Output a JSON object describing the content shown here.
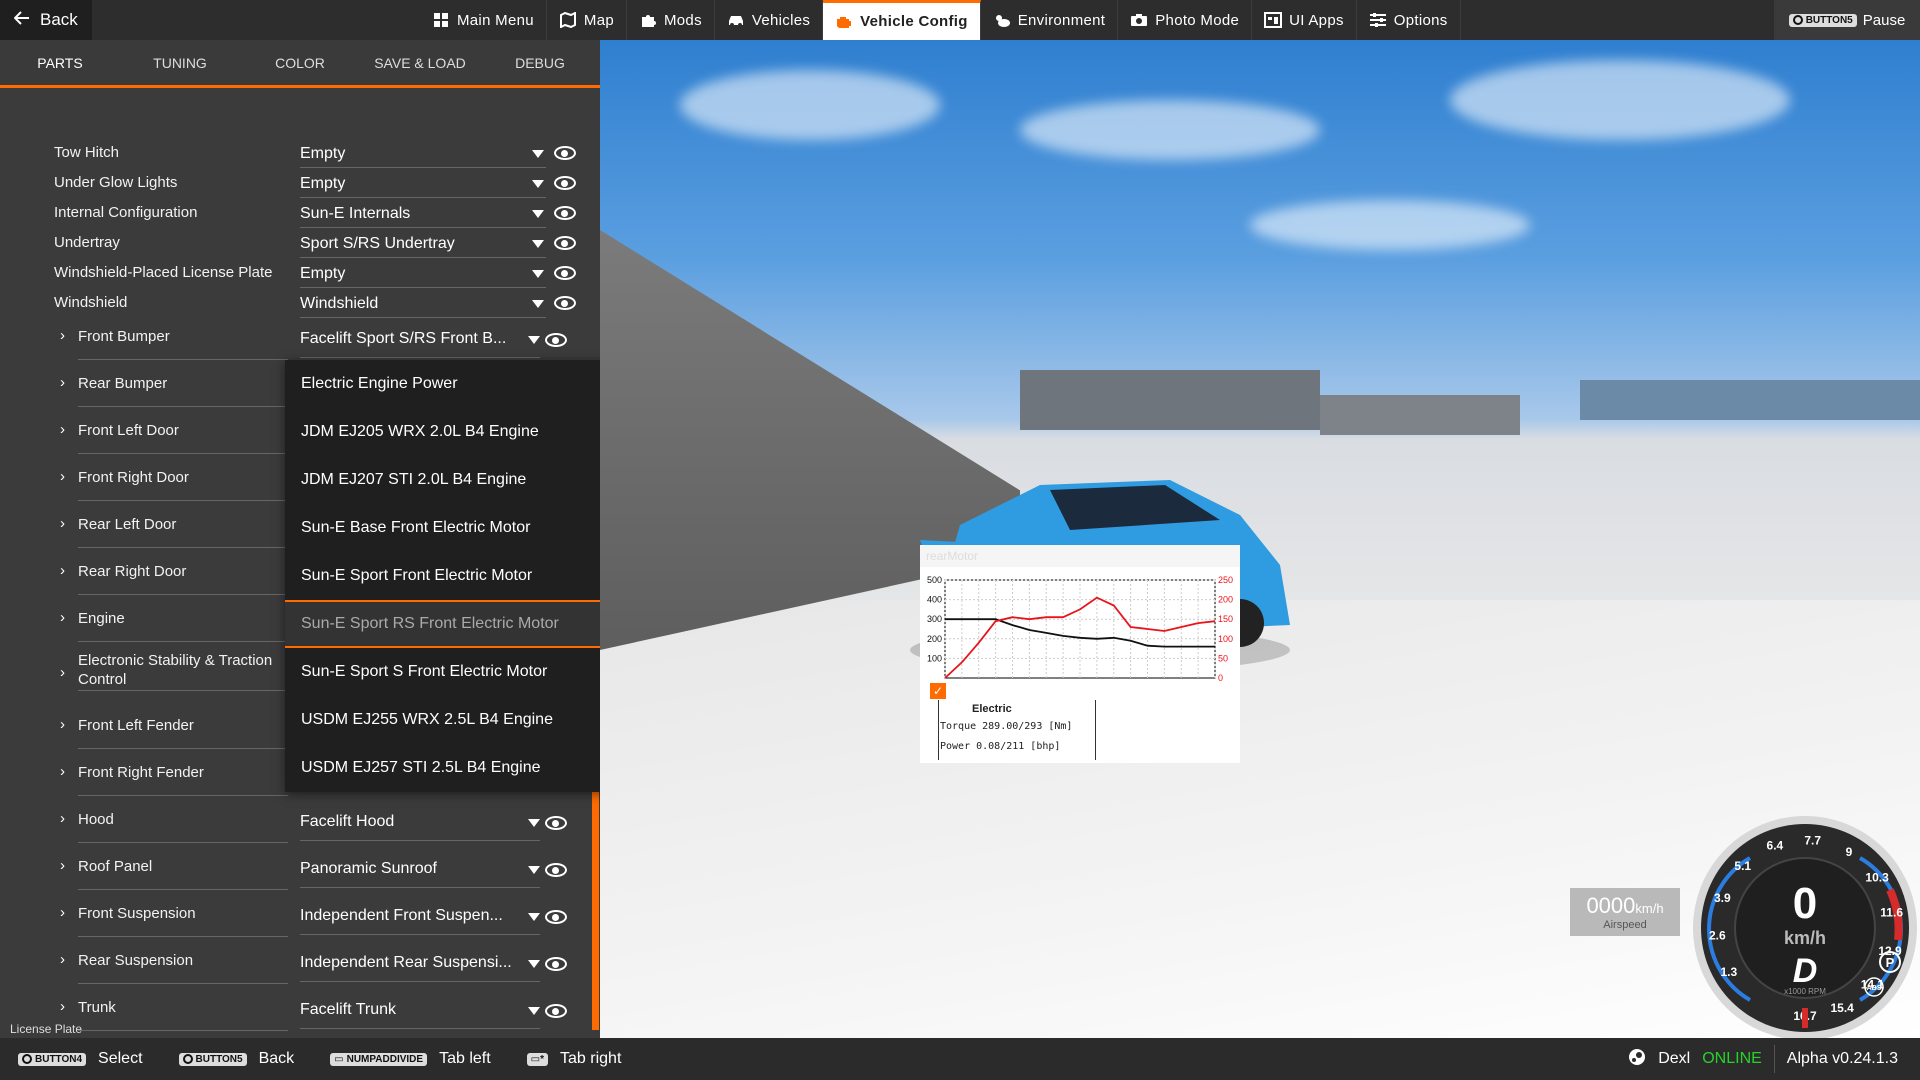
{
  "topbar": {
    "back_label": "Back",
    "nav": [
      {
        "label": "Main Menu",
        "icon": "grid-icon"
      },
      {
        "label": "Map",
        "icon": "map-icon"
      },
      {
        "label": "Mods",
        "icon": "puzzle-icon"
      },
      {
        "label": "Vehicles",
        "icon": "car-icon"
      },
      {
        "label": "Vehicle Config",
        "icon": "engine-icon",
        "active": true
      },
      {
        "label": "Environment",
        "icon": "weather-icon"
      },
      {
        "label": "Photo Mode",
        "icon": "camera-icon"
      },
      {
        "label": "UI Apps",
        "icon": "apps-icon"
      },
      {
        "label": "Options",
        "icon": "sliders-icon"
      }
    ],
    "pause_key": "BUTTON5",
    "pause_label": "Pause"
  },
  "panel": {
    "tabs": [
      "PARTS",
      "TUNING",
      "COLOR",
      "SAVE & LOAD",
      "DEBUG"
    ],
    "simple_rows": [
      {
        "label": "Tow Hitch",
        "value": "Empty"
      },
      {
        "label": "Under Glow Lights",
        "value": "Empty"
      },
      {
        "label": "Internal Configuration",
        "value": "Sun-E Internals"
      },
      {
        "label": "Undertray",
        "value": "Sport S/RS Undertray"
      },
      {
        "label": "Windshield-Placed License Plate",
        "value": "Empty"
      },
      {
        "label": "Windshield",
        "value": "Windshield"
      }
    ],
    "expand_rows": [
      {
        "label": "Front Bumper",
        "value": "Facelift Sport S/RS Front B..."
      },
      {
        "label": "Rear Bumper",
        "value": ""
      },
      {
        "label": "Front Left Door",
        "value": ""
      },
      {
        "label": "Front Right Door",
        "value": ""
      },
      {
        "label": "Rear Left Door",
        "value": ""
      },
      {
        "label": "Rear Right Door",
        "value": ""
      },
      {
        "label": "Engine",
        "value": ""
      },
      {
        "label": "Electronic Stability & Traction Control",
        "value": ""
      },
      {
        "label": "Front Left Fender",
        "value": ""
      },
      {
        "label": "Front Right Fender",
        "value": ""
      },
      {
        "label": "Hood",
        "value": "Facelift Hood"
      },
      {
        "label": "Roof Panel",
        "value": "Panoramic Sunroof"
      },
      {
        "label": "Front Suspension",
        "value": "Independent Front Suspen..."
      },
      {
        "label": "Rear Suspension",
        "value": "Independent Rear Suspensi..."
      },
      {
        "label": "Trunk",
        "value": "Facelift Trunk"
      }
    ],
    "bottom_label": "License Plate",
    "accent_color": "#ff6b00"
  },
  "dropdown": {
    "options": [
      "Electric Engine Power",
      "JDM EJ205 WRX 2.0L B4 Engine",
      "JDM EJ207 STI 2.0L B4 Engine",
      "Sun-E Base Front Electric Motor",
      "Sun-E Sport Front Electric Motor",
      "Sun-E Sport RS Front Electric Motor",
      "Sun-E Sport S Front Electric Motor",
      "USDM EJ255 WRX 2.5L B4 Engine",
      "USDM EJ257 STI 2.5L B4 Engine"
    ],
    "selected": "Sun-E Sport RS Front Electric Motor"
  },
  "torque_app": {
    "header": "rearMotor",
    "legend_title": "Electric",
    "torque_line": "Torque 289.00/293 [Nm]",
    "power_line": "Power  0.08/211   [bhp]"
  },
  "chart_data": {
    "type": "line",
    "x": [
      0,
      1000,
      2000,
      3000,
      4000,
      5000,
      6000,
      7000,
      8000,
      9000,
      10000,
      11000,
      12000,
      13000,
      14000,
      15000,
      16000
    ],
    "series": [
      {
        "name": "Torque",
        "axis": "left",
        "color": "#111111",
        "values": [
          300,
          300,
          300,
          300,
          270,
          245,
          230,
          215,
          205,
          200,
          205,
          190,
          165,
          160,
          160,
          160,
          160
        ]
      },
      {
        "name": "Power",
        "axis": "right",
        "color": "#e8141b",
        "values": [
          0,
          40,
          90,
          145,
          155,
          150,
          155,
          155,
          175,
          205,
          185,
          130,
          125,
          120,
          130,
          140,
          145
        ]
      }
    ],
    "ylim_left": [
      0,
      500
    ],
    "ylim_right": [
      0,
      250
    ],
    "yticks_left": [
      "500",
      "400",
      "300",
      "200",
      "100"
    ],
    "yticks_right": [
      "250",
      "200",
      "150",
      "100",
      "50",
      "0"
    ],
    "xlim": [
      0,
      16000
    ],
    "grid": true
  },
  "airspeed": {
    "value": "0000",
    "unit": "km/h",
    "label": "Airspeed"
  },
  "gauge": {
    "speed": "0",
    "unit": "km/h",
    "gear": "D",
    "rpm_label": "x1000 RPM",
    "ticks": [
      "1.3",
      "2.6",
      "3.9",
      "5.1",
      "6.4",
      "7.7",
      "9",
      "10.3",
      "11.6",
      "12.9",
      "14.1",
      "15.4",
      "16.7"
    ],
    "indicators": [
      "P",
      "ABS"
    ]
  },
  "bottombar": {
    "hints": [
      {
        "key": "BUTTON4",
        "label": "Select"
      },
      {
        "key": "BUTTON5",
        "label": "Back"
      },
      {
        "key": "NUMPADDIVIDE",
        "label": "Tab left"
      },
      {
        "key": "",
        "label": "Tab right"
      }
    ],
    "user": "Dexl",
    "status": "ONLINE",
    "version": "Alpha v0.24.1.3"
  }
}
